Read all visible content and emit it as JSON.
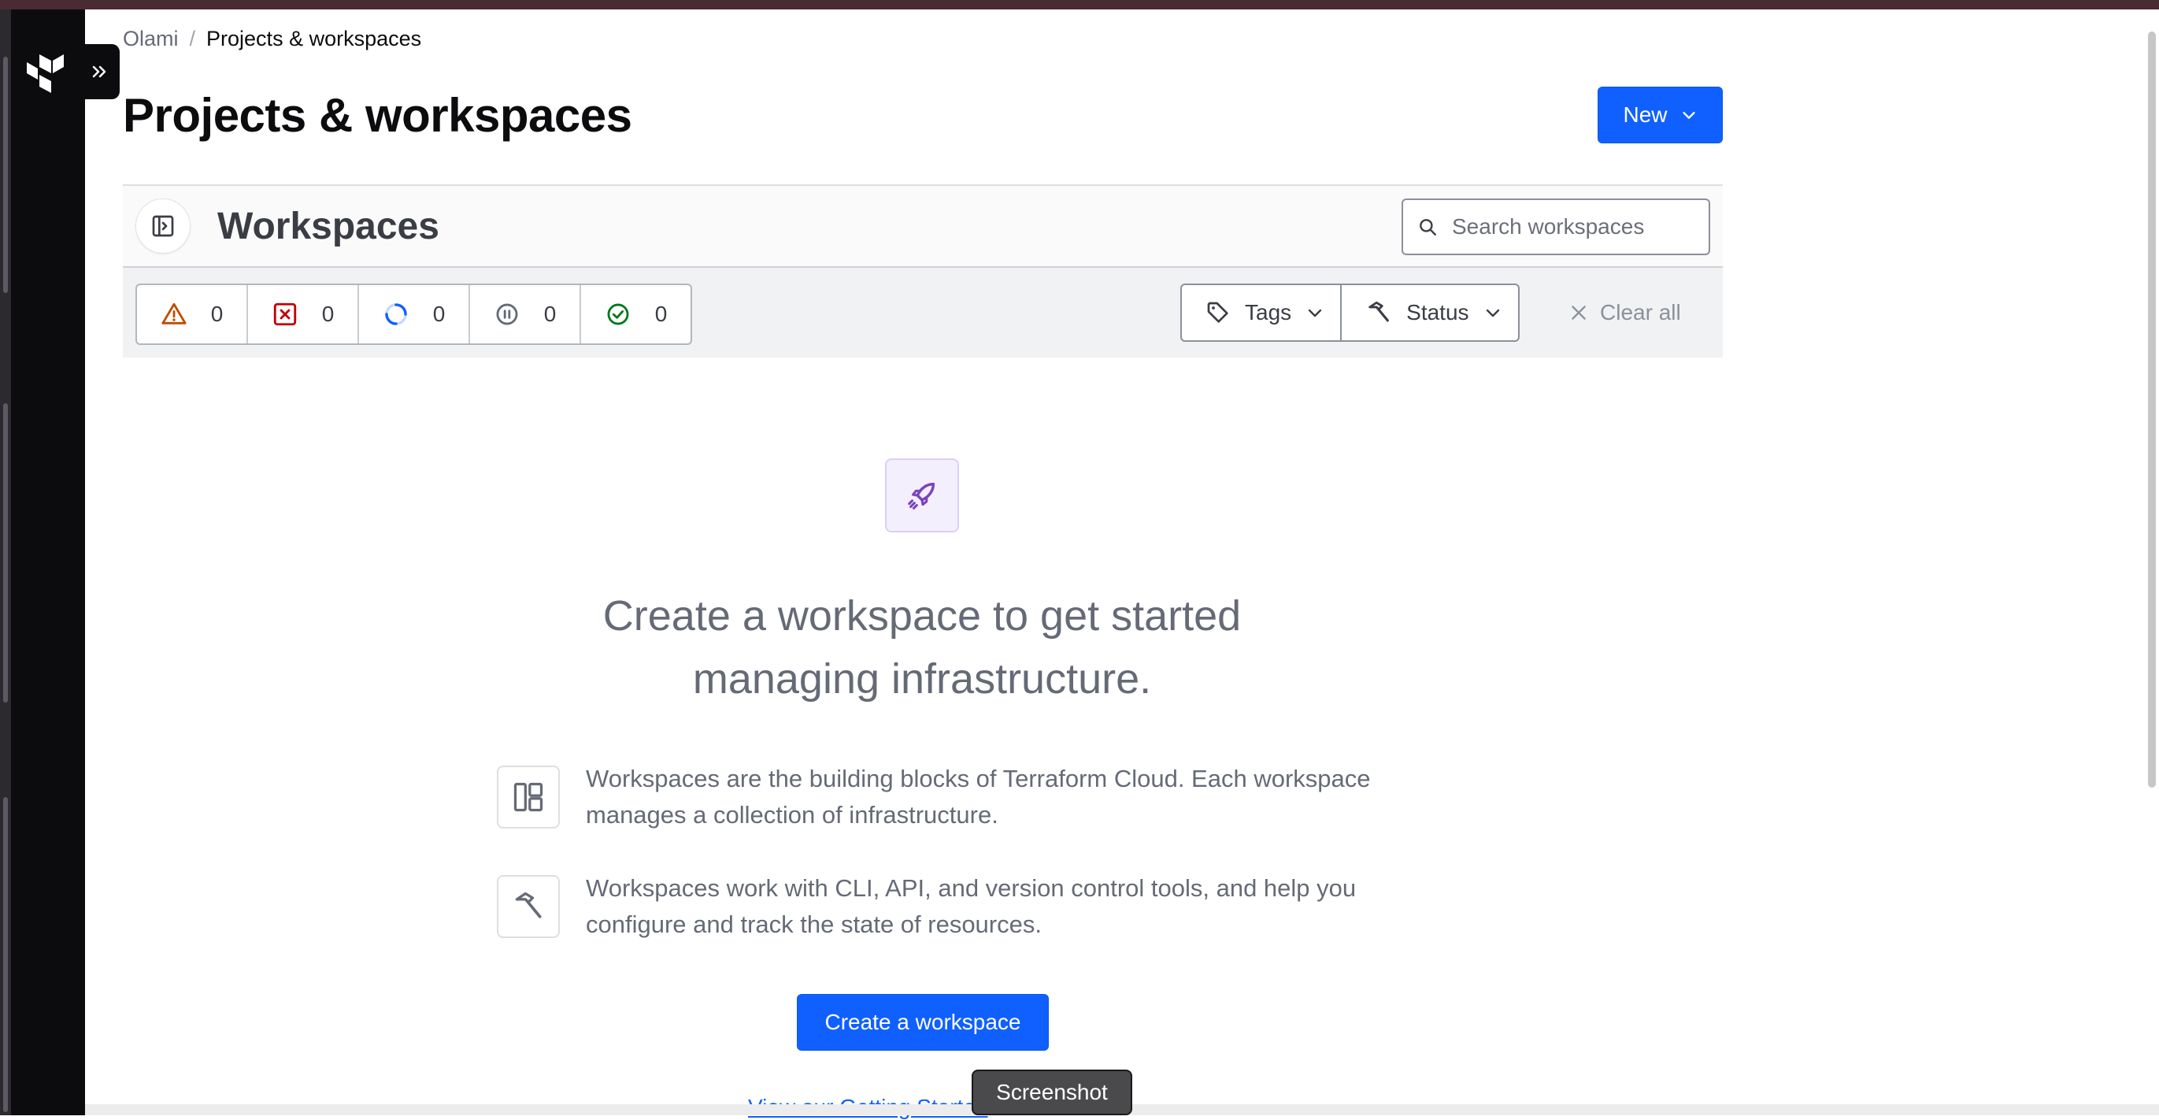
{
  "breadcrumb": {
    "org": "Olami",
    "separator": "/",
    "current": "Projects & workspaces"
  },
  "page": {
    "title": "Projects & workspaces",
    "new_button": "New"
  },
  "panel": {
    "title": "Workspaces",
    "search_placeholder": "Search workspaces"
  },
  "status_filters": [
    {
      "icon": "warning-triangle-icon",
      "count": "0",
      "color": "#c04c00"
    },
    {
      "icon": "error-x-square-icon",
      "count": "0",
      "color": "#c00005"
    },
    {
      "icon": "running-spinner-icon",
      "count": "0",
      "color": "#1060ff"
    },
    {
      "icon": "paused-circle-icon",
      "count": "0",
      "color": "#656a76"
    },
    {
      "icon": "success-check-circle-icon",
      "count": "0",
      "color": "#00781e"
    }
  ],
  "filters": {
    "tags": "Tags",
    "status": "Status",
    "clear_all": "Clear all"
  },
  "empty_state": {
    "heading": "Create a workspace to get started managing infrastructure.",
    "feature_1": "Workspaces are the building blocks of Terraform Cloud. Each workspace manages a collection of infrastructure.",
    "feature_2": "Workspaces work with CLI, API, and version control tools, and help you configure and track the state of resources.",
    "cta": "Create a workspace",
    "link": "View our Getting Started"
  },
  "tooltip": "Screenshot",
  "colors": {
    "accent": "#1060ff",
    "sidenav": "#0c0c0e",
    "rocket": "#7b42bc"
  }
}
